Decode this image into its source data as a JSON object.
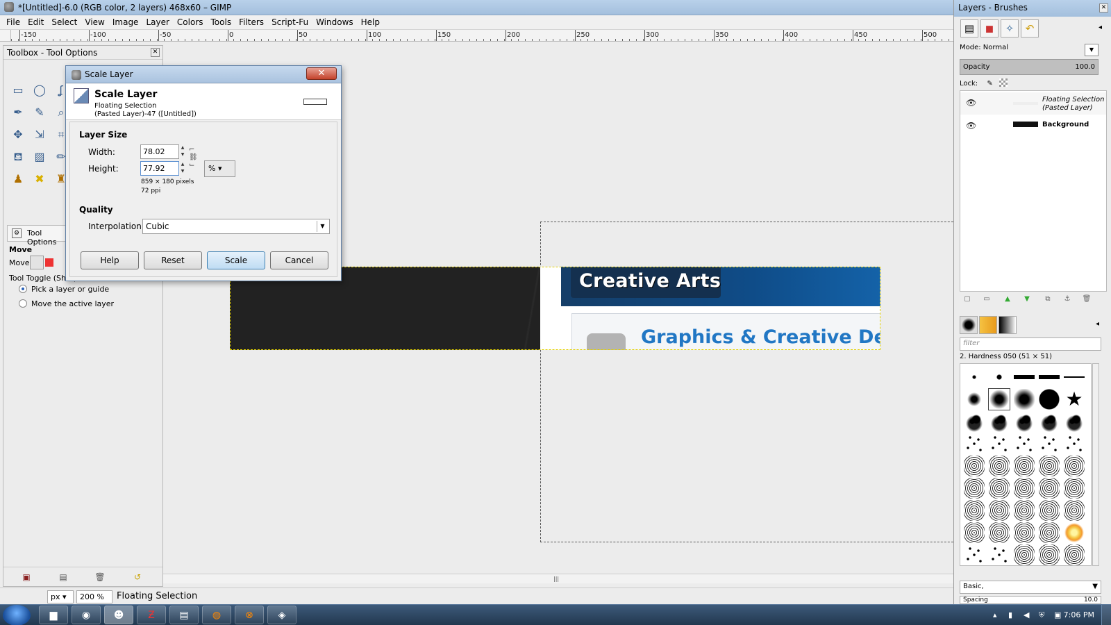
{
  "window": {
    "title": "*[Untitled]-6.0 (RGB color, 2 layers) 468x60 – GIMP"
  },
  "menu": [
    "File",
    "Edit",
    "Select",
    "View",
    "Image",
    "Layer",
    "Colors",
    "Tools",
    "Filters",
    "Script-Fu",
    "Windows",
    "Help"
  ],
  "ruler": {
    "labels": [
      "-150",
      "-100",
      "-50",
      "0",
      "50",
      "100",
      "150",
      "200",
      "250",
      "300",
      "350",
      "400",
      "450",
      "500"
    ]
  },
  "canvas": {
    "banner_title": "Creative Arts",
    "banner_subtitle": "Graphics & Creative Des"
  },
  "status": {
    "unit": "px",
    "zoom": "200 %",
    "text": "Floating Selection"
  },
  "toolbox": {
    "title": "Toolbox - Tool Options",
    "tool_options_tab": "Tool Options",
    "tool_name": "Move",
    "move_label": "Move:",
    "toggle_label": "Tool Toggle  (Shift)",
    "radio_options": [
      "Pick a layer or guide",
      "Move the active layer"
    ]
  },
  "dialog": {
    "title": "Scale Layer",
    "header_title": "Scale Layer",
    "header_sub1": "Floating Selection",
    "header_sub2": "(Pasted Layer)-47 ([Untitled])",
    "layer_size_label": "Layer Size",
    "width_label": "Width:",
    "width_value": "78.02",
    "height_label": "Height:",
    "height_value": "77.92",
    "unit": "%",
    "pixels_info": "859 × 180 pixels",
    "ppi_info": "72 ppi",
    "quality_label": "Quality",
    "interpolation_label": "Interpolation:",
    "interpolation_value": "Cubic",
    "buttons": {
      "help": "Help",
      "reset": "Reset",
      "scale": "Scale",
      "cancel": "Cancel"
    }
  },
  "dock": {
    "title": "Layers - Brushes",
    "mode_label": "Mode: Normal",
    "opacity_label": "Opacity",
    "opacity_value": "100.0",
    "lock_label": "Lock:",
    "layers": [
      {
        "name": "Floating Selection (Pasted Layer)",
        "name_line1": "Floating Selection",
        "name_line2": "(Pasted Layer)",
        "visible": true
      },
      {
        "name": "Background",
        "visible": true
      }
    ],
    "brush_filter_placeholder": "filter",
    "brush_name": "2. Hardness 050 (51 × 51)",
    "brush_set": "Basic,",
    "spacing_label": "Spacing",
    "spacing_value": "10.0"
  },
  "taskbar": {
    "clock": "7:06 PM"
  }
}
